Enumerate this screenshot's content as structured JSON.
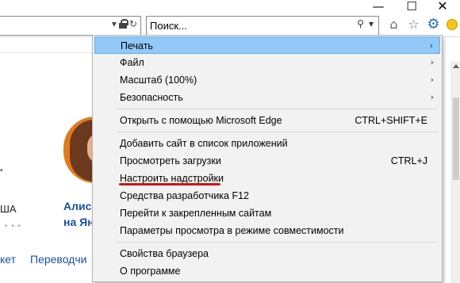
{
  "search": {
    "placeholder": "Поиск..."
  },
  "menu": {
    "items": [
      {
        "label": "Печать",
        "submenu": true
      },
      {
        "label": "Файл",
        "submenu": true
      },
      {
        "label": "Масштаб (100%)",
        "submenu": true
      },
      {
        "label": "Безопасность",
        "submenu": true
      },
      {
        "label": "Открыть с помощью Microsoft Edge",
        "shortcut": "CTRL+SHIFT+E"
      },
      {
        "label": "Добавить сайт в список приложений"
      },
      {
        "label": "Просмотреть загрузки",
        "shortcut": "CTRL+J"
      },
      {
        "label": "Настроить надстройки"
      },
      {
        "label": "Средства разработчика F12"
      },
      {
        "label": "Перейти к закрепленным сайтам"
      },
      {
        "label": "Параметры просмотра в режиме совместимости"
      },
      {
        "label": "Свойства браузера"
      },
      {
        "label": "О программе"
      }
    ],
    "highlighted_index": 0,
    "underlined_index": 7,
    "highlight_color": "#91c9f7",
    "underline_color": "#d0121b"
  },
  "background": {
    "sha": "ША",
    "dots": "• • •",
    "alis_line1": "Алис",
    "alis_line2": "на Ян",
    "ket": "кет",
    "perevod": "Переводчи"
  }
}
